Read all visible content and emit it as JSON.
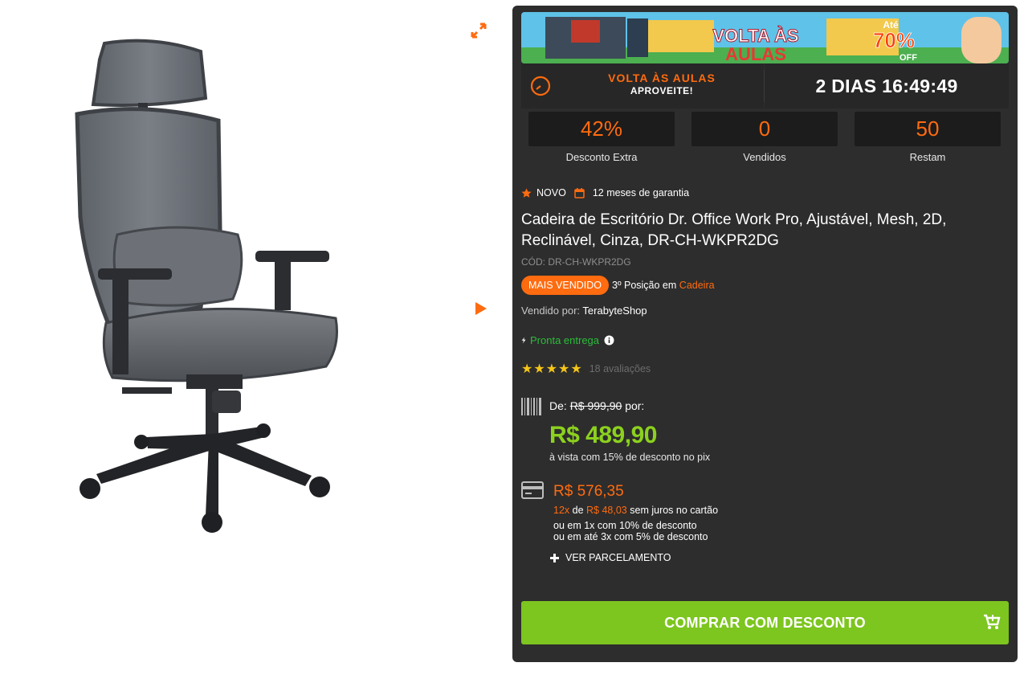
{
  "banner": {
    "headline_line1": "VOLTA ÀS",
    "headline_line2": "AULAS",
    "promo_prefix": "Até",
    "promo_value": "70%",
    "promo_suffix": "OFF"
  },
  "timer": {
    "title": "VOLTA ÀS AULAS",
    "subtitle": "APROVEITE!",
    "countdown": "2 DIAS 16:49:49"
  },
  "stats": [
    {
      "value": "42%",
      "label": "Desconto Extra"
    },
    {
      "value": "0",
      "label": "Vendidos"
    },
    {
      "value": "50",
      "label": "Restam"
    }
  ],
  "product": {
    "condition": "NOVO",
    "warranty": "12 meses de garantia",
    "title": "Cadeira de Escritório Dr. Office Work Pro, Ajustável, Mesh, 2D, Reclinável, Cinza, DR-CH-WKPR2DG",
    "sku": "CÓD: DR-CH-WKPR2DG",
    "best_seller_badge": "MAIS VENDIDO",
    "rank_text": "3º Posição em",
    "rank_category": "Cadeira",
    "sold_by_label": "Vendido por:",
    "seller": "TerabyteShop",
    "delivery": "Pronta entrega",
    "stars": "★★★★★",
    "rating_value": 5,
    "reviews": "18 avaliações"
  },
  "pricing": {
    "from_label": "De:",
    "old_price": "R$ 999,90",
    "for_label": "por:",
    "price": "R$ 489,90",
    "pix_note": "à vista com 15% de desconto no pix",
    "card_price": "R$ 576,35",
    "installments_count": "12x",
    "installments_of": "de",
    "installment_value": "R$ 48,03",
    "installments_note": "sem juros no cartão",
    "option1": "ou em 1x com 10% de desconto",
    "option2": "ou em até 3x com 5% de desconto",
    "parcel_link": "VER PARCELAMENTO"
  },
  "cta": {
    "buy_label": "COMPRAR COM DESCONTO"
  },
  "colors": {
    "accent": "#ff6b0f",
    "price_green": "#8cd11e",
    "button_green": "#7dc51f",
    "panel_bg": "#2d2d2d",
    "delivery_green": "#2bbd3a",
    "star": "#f5c518"
  },
  "icons": [
    "expand-icon",
    "next-arrow-icon",
    "clock-icon",
    "star-icon",
    "calendar-icon",
    "bolt-icon",
    "info-icon",
    "barcode-icon",
    "credit-card-icon",
    "plus-icon",
    "cart-icon"
  ]
}
